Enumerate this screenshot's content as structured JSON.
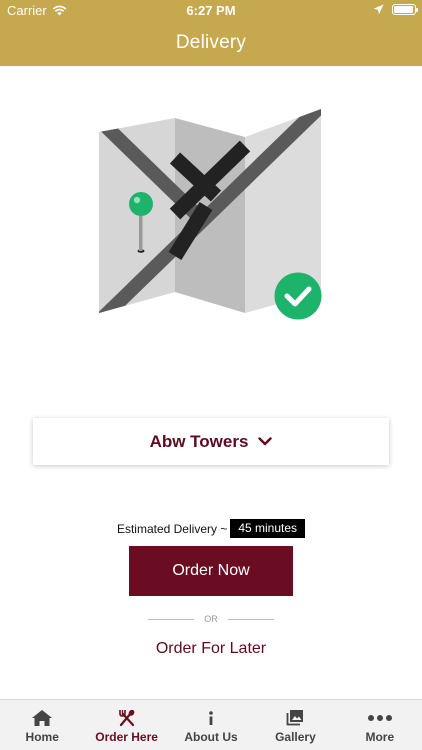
{
  "status_bar": {
    "carrier": "Carrier",
    "time": "6:27 PM"
  },
  "navbar": {
    "title": "Delivery"
  },
  "location": {
    "name": "Abw Towers"
  },
  "delivery": {
    "estimate_label": "Estimated Delivery ~",
    "estimate_value": "45 minutes"
  },
  "actions": {
    "order_now": "Order Now",
    "or_text": "OR",
    "order_later": "Order For Later"
  },
  "tabs": [
    {
      "label": "Home",
      "icon": "home-icon"
    },
    {
      "label": "Order Here",
      "icon": "fork-spoon-icon",
      "active": true
    },
    {
      "label": "About Us",
      "icon": "info-icon"
    },
    {
      "label": "Gallery",
      "icon": "gallery-icon"
    },
    {
      "label": "More",
      "icon": "more-dots-icon"
    }
  ],
  "colors": {
    "brand_gold": "#c6a84e",
    "brand_maroon": "#6a0c22",
    "success_green": "#1db36b"
  }
}
